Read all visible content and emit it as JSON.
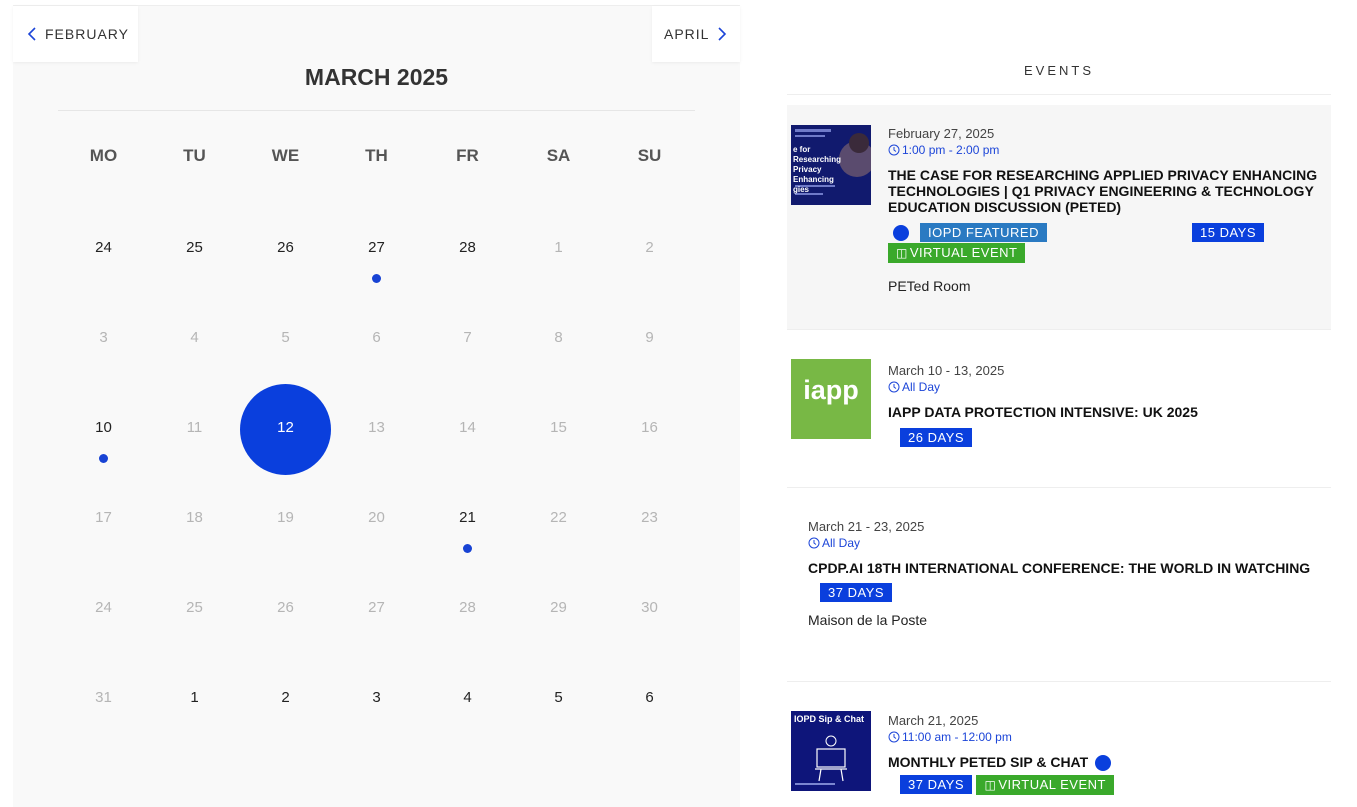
{
  "calendar": {
    "prev_label": "FEBRUARY",
    "next_label": "APRIL",
    "month_title": "MARCH 2025",
    "weekdays": [
      "MO",
      "TU",
      "WE",
      "TH",
      "FR",
      "SA",
      "SU"
    ],
    "weeks": [
      [
        {
          "day": "24",
          "state": "active"
        },
        {
          "day": "25",
          "state": "active"
        },
        {
          "day": "26",
          "state": "active"
        },
        {
          "day": "27",
          "state": "active",
          "has_event": true
        },
        {
          "day": "28",
          "state": "active"
        },
        {
          "day": "1",
          "state": "inactive"
        },
        {
          "day": "2",
          "state": "inactive"
        }
      ],
      [
        {
          "day": "3",
          "state": "inactive"
        },
        {
          "day": "4",
          "state": "inactive"
        },
        {
          "day": "5",
          "state": "inactive"
        },
        {
          "day": "6",
          "state": "inactive"
        },
        {
          "day": "7",
          "state": "inactive"
        },
        {
          "day": "8",
          "state": "inactive"
        },
        {
          "day": "9",
          "state": "inactive"
        }
      ],
      [
        {
          "day": "10",
          "state": "active",
          "has_event": true
        },
        {
          "day": "11",
          "state": "inactive"
        },
        {
          "day": "12",
          "state": "today"
        },
        {
          "day": "13",
          "state": "inactive"
        },
        {
          "day": "14",
          "state": "inactive"
        },
        {
          "day": "15",
          "state": "inactive"
        },
        {
          "day": "16",
          "state": "inactive"
        }
      ],
      [
        {
          "day": "17",
          "state": "inactive"
        },
        {
          "day": "18",
          "state": "inactive"
        },
        {
          "day": "19",
          "state": "inactive"
        },
        {
          "day": "20",
          "state": "inactive"
        },
        {
          "day": "21",
          "state": "active",
          "has_event": true
        },
        {
          "day": "22",
          "state": "inactive"
        },
        {
          "day": "23",
          "state": "inactive"
        }
      ],
      [
        {
          "day": "24",
          "state": "inactive"
        },
        {
          "day": "25",
          "state": "inactive"
        },
        {
          "day": "26",
          "state": "inactive"
        },
        {
          "day": "27",
          "state": "inactive"
        },
        {
          "day": "28",
          "state": "inactive"
        },
        {
          "day": "29",
          "state": "inactive"
        },
        {
          "day": "30",
          "state": "inactive"
        }
      ],
      [
        {
          "day": "31",
          "state": "inactive"
        },
        {
          "day": "1",
          "state": "active"
        },
        {
          "day": "2",
          "state": "active"
        },
        {
          "day": "3",
          "state": "active"
        },
        {
          "day": "4",
          "state": "active"
        },
        {
          "day": "5",
          "state": "active"
        },
        {
          "day": "6",
          "state": "active"
        }
      ]
    ]
  },
  "events": {
    "heading": "EVENTS",
    "items": [
      {
        "date": "February 27, 2025",
        "time": "1:00 pm - 2:00 pm",
        "title": "THE CASE FOR RESEARCHING APPLIED PRIVACY ENHANCING TECHNOLOGIES | Q1 PRIVACY ENGINEERING & TECHNOLOGY EDUCATION DISCUSSION (PETED)",
        "featured_label": "IOPD FEATURED",
        "days_label": "15 DAYS",
        "virtual_label": "VIRTUAL EVENT",
        "location": "PETed Room",
        "thumb_text": "e for Researching Privacy Enhancing gies"
      },
      {
        "date": "March 10 - 13, 2025",
        "time": "All Day",
        "title": "IAPP DATA PROTECTION INTENSIVE: UK 2025",
        "days_label": "26 DAYS",
        "thumb_text": "iapp"
      },
      {
        "date": "March 21 - 23, 2025",
        "time": "All Day",
        "title": "CPDP.AI 18TH INTERNATIONAL CONFERENCE: THE WORLD IN WATCHING",
        "days_label": "37 DAYS",
        "location": "Maison de la Poste"
      },
      {
        "date": "March 21, 2025",
        "time": "11:00 am - 12:00 pm",
        "title": "MONTHLY PETED SIP & CHAT",
        "days_label": "37 DAYS",
        "virtual_label": "VIRTUAL EVENT",
        "thumb_text": "IOPD Sip & Chat"
      }
    ]
  },
  "colors": {
    "accent_blue": "#0a3fdd",
    "featured_blue": "#2a7ac2",
    "virtual_green": "#3aa92b",
    "iapp_green": "#78b845"
  }
}
